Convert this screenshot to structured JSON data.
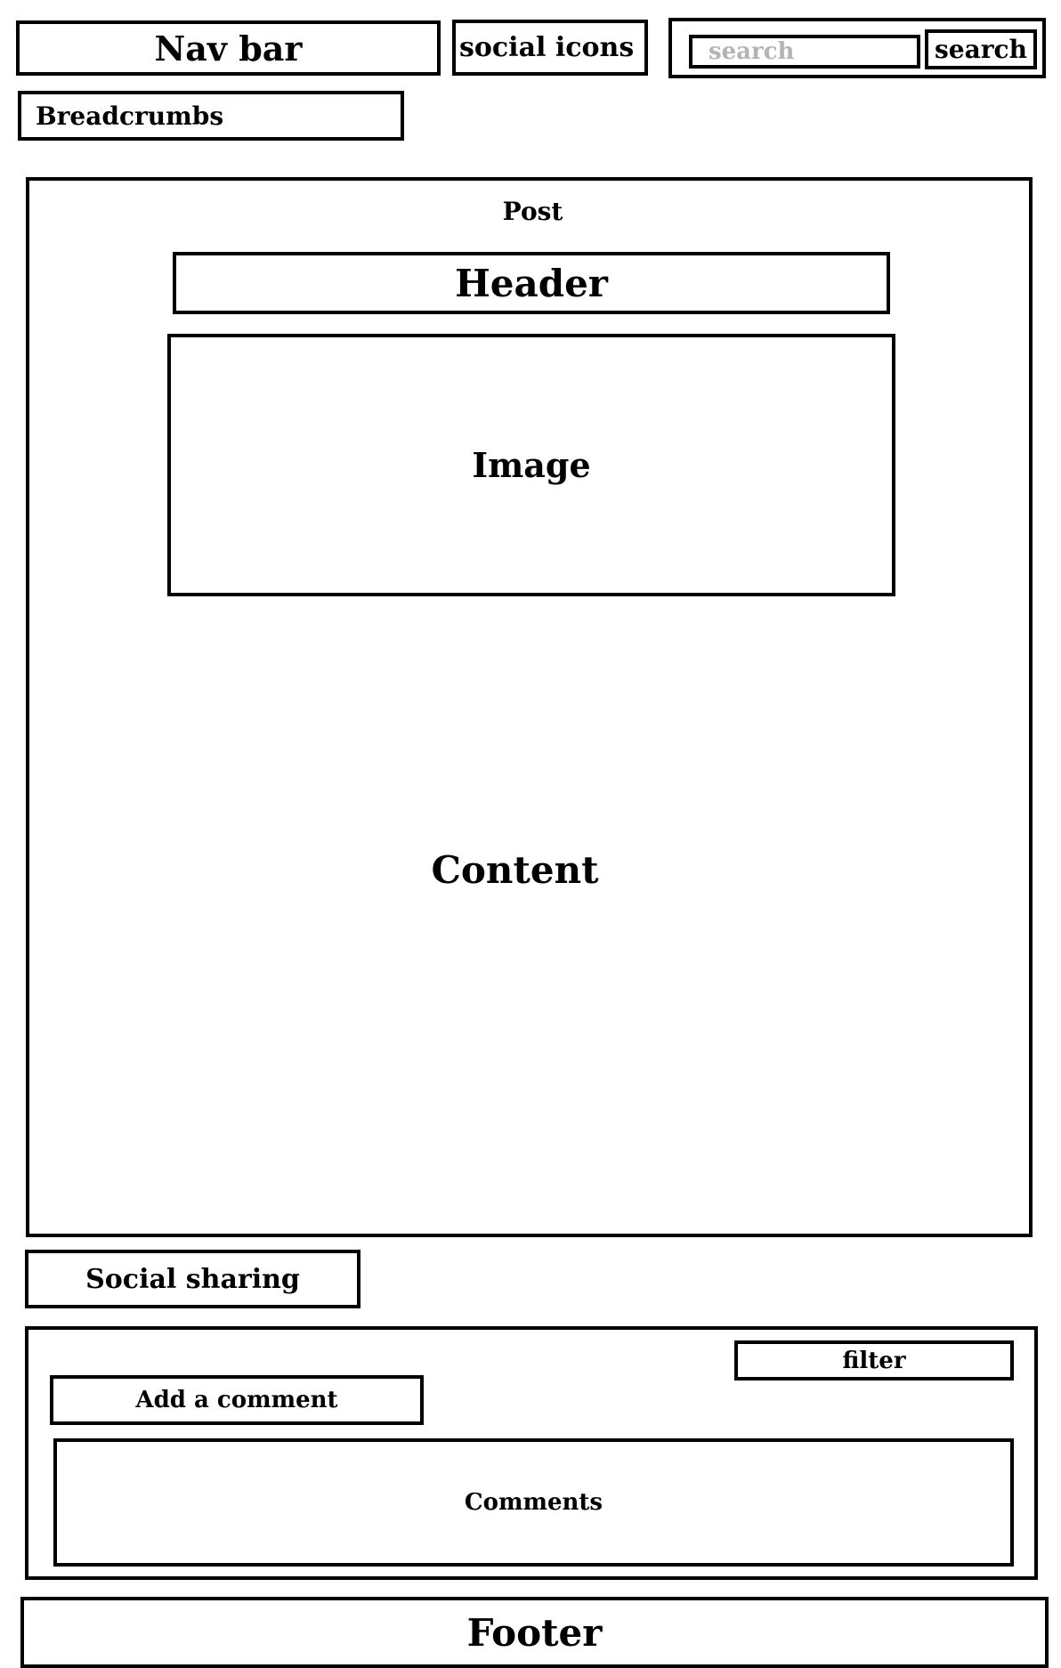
{
  "header": {
    "nav_label": "Nav bar",
    "social_label": "social icons",
    "search": {
      "placeholder": "search",
      "button_label": "search"
    }
  },
  "breadcrumbs_label": "Breadcrumbs",
  "post": {
    "label": "Post",
    "header_label": "Header",
    "image_label": "Image",
    "content_label": "Content"
  },
  "social_sharing_label": "Social sharing",
  "comments": {
    "filter_label": "filter",
    "add_label": "Add a comment",
    "list_label": "Comments"
  },
  "footer_label": "Footer"
}
